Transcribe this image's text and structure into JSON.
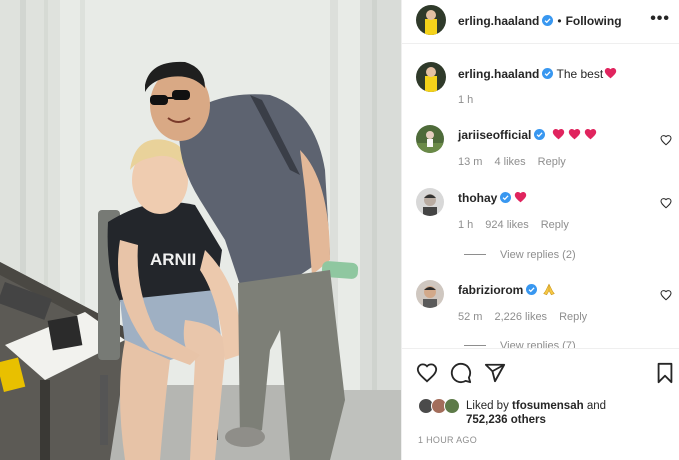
{
  "post": {
    "author": "erling.haaland",
    "dot": "•",
    "following_label": "Following",
    "more_label": "•••"
  },
  "caption": {
    "username": "erling.haaland",
    "text": "The best",
    "time": "1 h"
  },
  "comments": [
    {
      "username": "jariiseofficial",
      "emoji": "heart heart heart",
      "time": "13 m",
      "likes": "4 likes",
      "reply": "Reply"
    },
    {
      "username": "thohay",
      "emoji": "heart",
      "time": "1 h",
      "likes": "924 likes",
      "reply": "Reply",
      "view_replies": "View replies (2)"
    },
    {
      "username": "fabriziorom",
      "emoji": "folded-hands",
      "time": "52 m",
      "likes": "2,226 likes",
      "reply": "Reply",
      "view_replies": "View replies (7)"
    }
  ],
  "likes": {
    "prefix": "Liked by",
    "user": "tfosumensah",
    "and": "and",
    "others": "752,236 others"
  },
  "timestamp": "1 HOUR AGO",
  "photo_text": {
    "shirt": "ARNII"
  },
  "colors": {
    "verified": "#3897f0",
    "heart": "#e0245e",
    "muted": "#8e8e8e"
  },
  "icons": [
    "heart-icon",
    "comment-icon",
    "share-icon",
    "bookmark-icon",
    "more-icon",
    "verified-icon"
  ]
}
